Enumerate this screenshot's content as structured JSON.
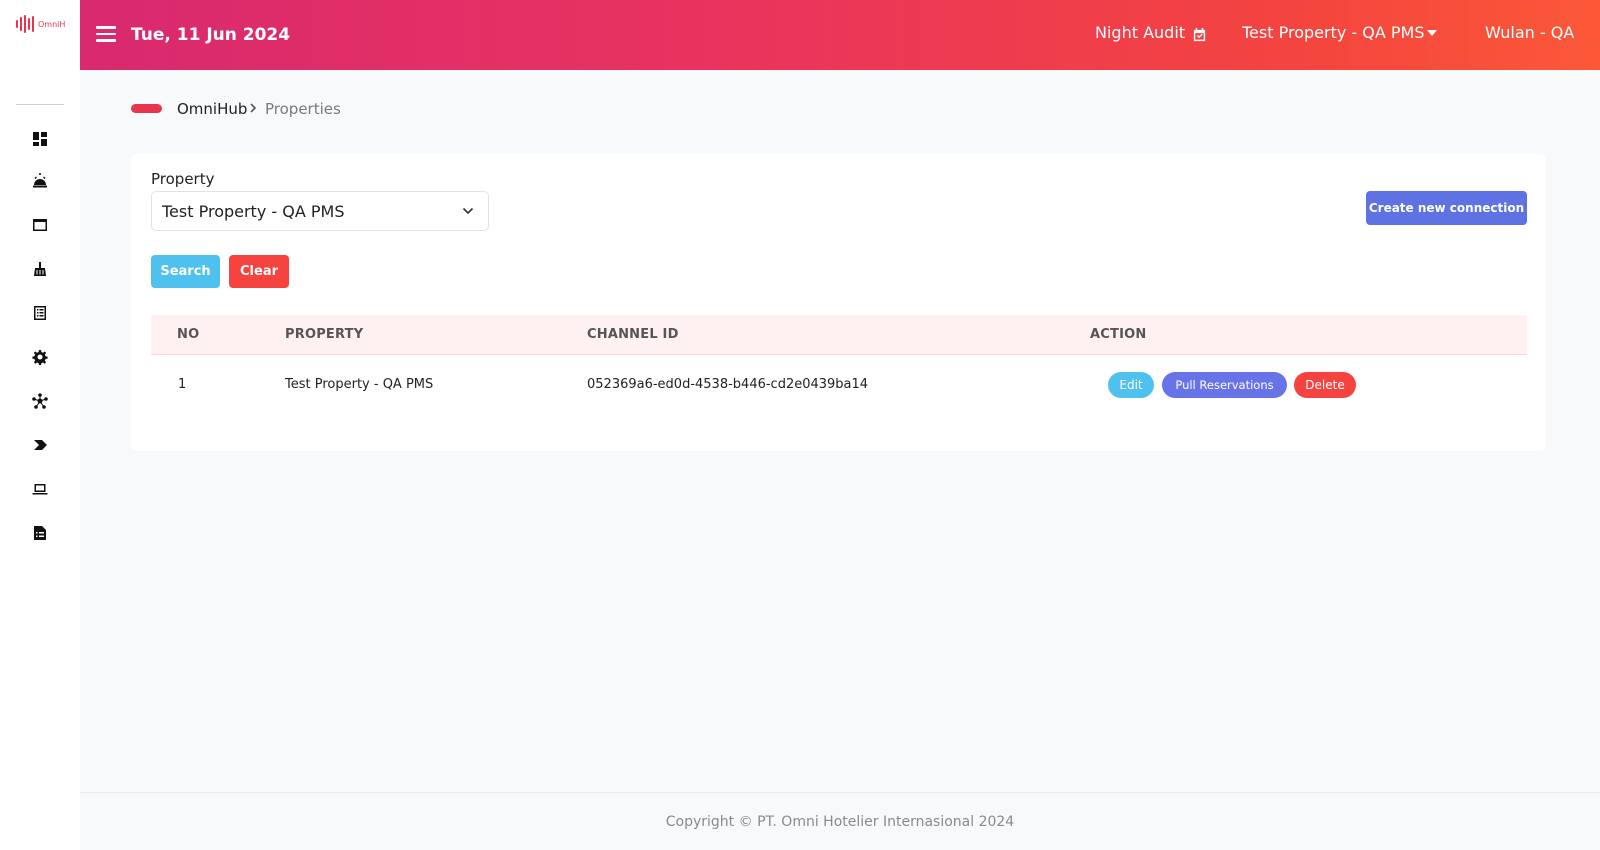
{
  "app": {
    "logo_text": "OmniH"
  },
  "sidebar": {
    "items": [
      {
        "icon": "dashboard-icon"
      },
      {
        "icon": "concierge-bell-icon"
      },
      {
        "icon": "window-icon"
      },
      {
        "icon": "broom-icon"
      },
      {
        "icon": "list-icon"
      },
      {
        "icon": "gear-icon"
      },
      {
        "icon": "network-icon"
      },
      {
        "icon": "chevron-tag-icon"
      },
      {
        "icon": "laptop-icon"
      },
      {
        "icon": "report-icon"
      }
    ]
  },
  "header": {
    "date": "Tue, 11 Jun 2024",
    "night_audit_label": "Night Audit",
    "property_selected": "Test Property - QA PMS",
    "user": "Wulan - QA",
    "gradient_start": "#d9296f",
    "gradient_end": "#fb5838"
  },
  "breadcrumb": {
    "root": "OmniHub",
    "current": "Properties"
  },
  "filter": {
    "property_label": "Property",
    "property_value": "Test Property - QA PMS",
    "search_label": "Search",
    "clear_label": "Clear",
    "create_label": "Create new connection"
  },
  "table": {
    "columns": [
      "NO",
      "PROPERTY",
      "CHANNEL ID",
      "ACTION"
    ],
    "rows": [
      {
        "no": "1",
        "property": "Test Property - QA PMS",
        "channel_id": "052369a6-ed0d-4538-b446-cd2e0439ba14",
        "actions": [
          "Edit",
          "Pull Reservations",
          "Delete"
        ]
      }
    ]
  },
  "footer": {
    "copyright": "Copyright © PT. Omni Hotelier Internasional 2024"
  },
  "colors": {
    "accent": "#e8344e",
    "primary": "#5e72e4",
    "info": "#4fc1ee",
    "danger": "#f5443f"
  }
}
